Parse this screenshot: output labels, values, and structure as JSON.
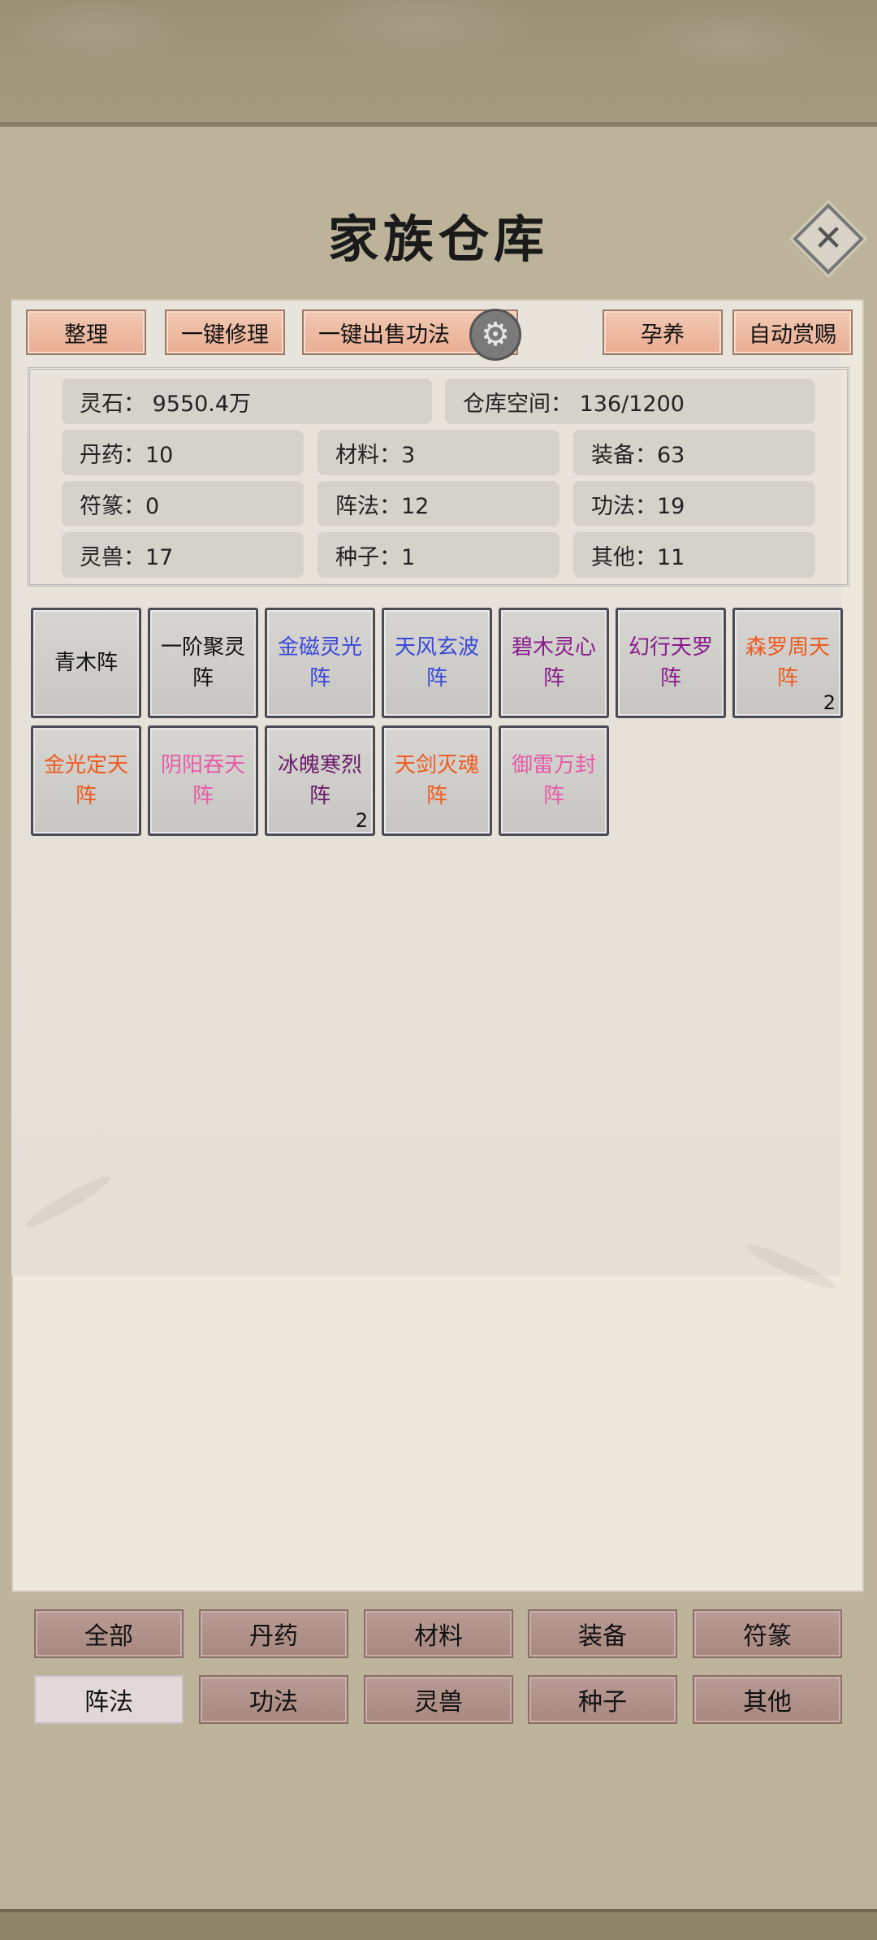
{
  "title": "家族仓库",
  "toolbar": {
    "sort": "整理",
    "repair_all": "一键修理",
    "sell_all_skills": "一键出售功法",
    "breed": "孕养",
    "auto_reward": "自动赏赐"
  },
  "stats": {
    "spirit_stone": "灵石：  9550.4万",
    "storage_space": "仓库空间：   136/1200",
    "pills": "丹药：10",
    "materials": "材料：3",
    "equipment": "装备：63",
    "talismans": "符篆：0",
    "formations": "阵法：12",
    "skills": "功法：19",
    "beasts": "灵兽：17",
    "seeds": "种子：1",
    "others": "其他：11"
  },
  "items": [
    {
      "name": "青木阵",
      "color": "#111111",
      "count": ""
    },
    {
      "name": "一阶聚灵阵",
      "color": "#111111",
      "count": ""
    },
    {
      "name": "金磁灵光阵",
      "color": "#3a48d8",
      "count": ""
    },
    {
      "name": "天风玄波阵",
      "color": "#3a48d8",
      "count": ""
    },
    {
      "name": "碧木灵心阵",
      "color": "#8a1a8c",
      "count": ""
    },
    {
      "name": "幻行天罗阵",
      "color": "#8a1a8c",
      "count": ""
    },
    {
      "name": "森罗周天阵",
      "color": "#ef5a1e",
      "count": "2"
    },
    {
      "name": "金光定天阵",
      "color": "#ef5a1e",
      "count": ""
    },
    {
      "name": "阴阳吞天阵",
      "color": "#e85aa8",
      "count": ""
    },
    {
      "name": "冰魄寒烈阵",
      "color": "#6a1a6a",
      "count": "2"
    },
    {
      "name": "天剑灭魂阵",
      "color": "#ef5a1e",
      "count": ""
    },
    {
      "name": "御雷万封阵",
      "color": "#e85aa8",
      "count": ""
    }
  ],
  "categories": [
    "全部",
    "丹药",
    "材料",
    "装备",
    "符篆",
    "阵法",
    "功法",
    "灵兽",
    "种子",
    "其他"
  ],
  "active_category": "阵法",
  "icons": {
    "close": "close-icon",
    "gear": "gear-icon"
  }
}
